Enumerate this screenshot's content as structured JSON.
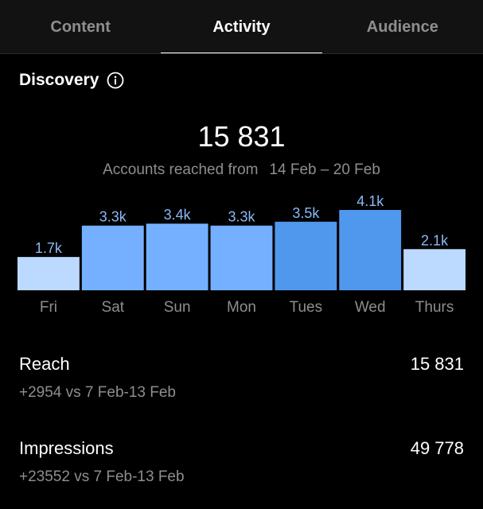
{
  "tabs": [
    {
      "label": "Content",
      "active": false
    },
    {
      "label": "Activity",
      "active": true
    },
    {
      "label": "Audience",
      "active": false
    }
  ],
  "section": {
    "title": "Discovery",
    "icon": "info-icon"
  },
  "accounts_reached": {
    "value": "15 831",
    "label": "Accounts reached from",
    "range": "14 Feb – 20 Feb"
  },
  "colors": {
    "bar_light": "#bcd9ff",
    "bar_medium": "#74b0ff",
    "bar_strong": "#5097ee",
    "label_blue": "#8ab8f5"
  },
  "chart_data": {
    "type": "bar",
    "categories": [
      "Fri",
      "Sat",
      "Sun",
      "Mon",
      "Tues",
      "Wed",
      "Thurs"
    ],
    "values": [
      1.7,
      3.3,
      3.4,
      3.3,
      3.5,
      4.1,
      2.1
    ],
    "data_labels": [
      "1.7k",
      "3.3k",
      "3.4k",
      "3.3k",
      "3.5k",
      "4.1k",
      "2.1k"
    ],
    "bar_tones": [
      "light",
      "medium",
      "medium",
      "medium",
      "strong",
      "strong",
      "light"
    ],
    "unit": "k",
    "ylim": [
      0,
      4.1
    ],
    "title": "",
    "xlabel": "",
    "ylabel": "",
    "grid": false
  },
  "stats": [
    {
      "label": "Reach",
      "value": "15 831",
      "comparison": "+2954 vs 7 Feb-13 Feb"
    },
    {
      "label": "Impressions",
      "value": "49 778",
      "comparison": "+23552 vs 7 Feb-13 Feb"
    }
  ]
}
